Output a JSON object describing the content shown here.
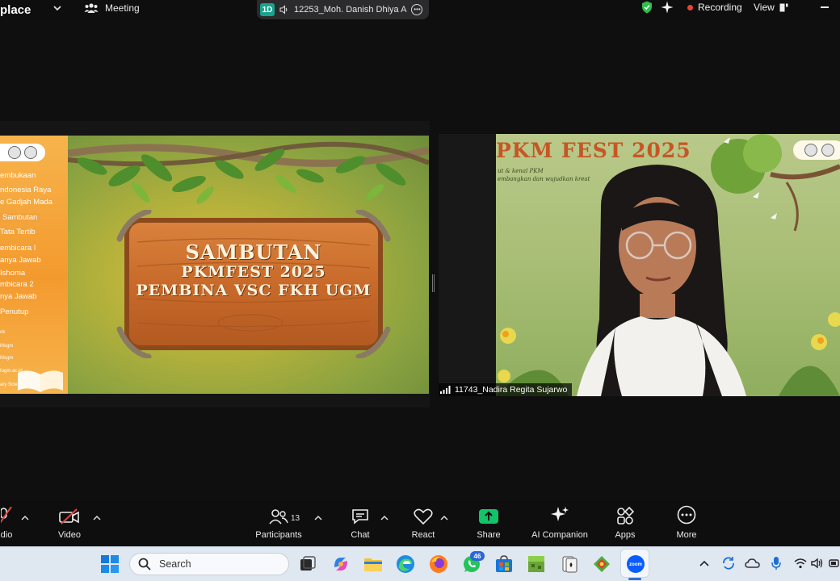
{
  "topbar": {
    "app_name": "place",
    "meeting_label": "Meeting",
    "share_badge": "1D",
    "share_name": "12253_Moh. Danish Dhiya A",
    "recording_label": "Recording",
    "view_label": "View"
  },
  "slide": {
    "agenda": [
      "embukaan",
      "ndonesia Raya",
      "e Gadjah Mada",
      "Sambutan",
      "Tata Tertib",
      "embicara I",
      "anya Jawab",
      "Ishoma",
      "mbicara 2",
      "nya Jawab",
      "Penutup"
    ],
    "small_lines": [
      "ok",
      "Msgm",
      "Msgm",
      "fugm.ac.id",
      "ary Science Community"
    ],
    "board_line1": "SAMBUTAN",
    "board_line2": "PKMFEST 2025",
    "board_line3": "PEMBINA VSC FKH UGM"
  },
  "tile": {
    "title": "PKM FEST 2025",
    "sub1": "ut & kenal PKM",
    "sub2": "embangkan dan wujudkan kreat",
    "participant_name": "11743_Nadira Regita Sujarwo"
  },
  "toolbar": {
    "audio_label": "dio",
    "video_label": "Video",
    "participants_label": "Participants",
    "participants_count": "13",
    "chat_label": "Chat",
    "react_label": "React",
    "share_label": "Share",
    "ai_label": "AI Companion",
    "apps_label": "Apps",
    "more_label": "More"
  },
  "taskbar": {
    "search_label": "Search",
    "whatsapp_badge": "46",
    "zoom_label": "zoom"
  },
  "colors": {
    "background": "#0f0f10",
    "share_green": "#19a38e",
    "recording_red": "#e4453a",
    "share_button_green": "#12c36a",
    "taskbar": "#dfe7f1"
  }
}
